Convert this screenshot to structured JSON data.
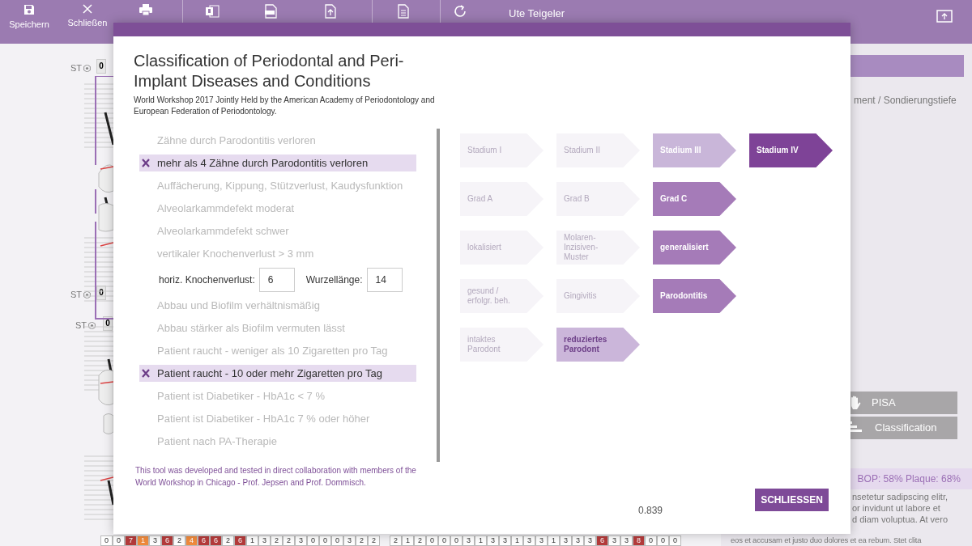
{
  "toolbar": {
    "buttons": [
      {
        "label": "Speichern"
      },
      {
        "label": "Schließen"
      }
    ],
    "patient_name": "Ute Teigeler"
  },
  "background_chart": {
    "st_rows": [
      {
        "label": "ST",
        "value": "0"
      },
      {
        "label": "ST",
        "value": "0"
      },
      {
        "label": "ST",
        "value": "0"
      }
    ],
    "bottom_cells": [
      {
        "value": "0",
        "color": "#ffffff"
      },
      {
        "value": "0",
        "color": "#ffffff"
      },
      {
        "value": "7",
        "color": "#b53b3b"
      },
      {
        "value": "1",
        "color": "#f08a3c"
      },
      {
        "value": "3",
        "color": "#ffffff"
      },
      {
        "value": "6",
        "color": "#b53b3b"
      },
      {
        "value": "2",
        "color": "#ffffff"
      },
      {
        "value": "4",
        "color": "#f08a3c"
      },
      {
        "value": "6",
        "color": "#b53b3b"
      },
      {
        "value": "6",
        "color": "#b53b3b"
      },
      {
        "value": "2",
        "color": "#ffffff"
      },
      {
        "value": "6",
        "color": "#b53b3b"
      },
      {
        "value": "1",
        "color": "#ffffff"
      },
      {
        "value": "3",
        "color": "#ffffff"
      },
      {
        "value": "2",
        "color": "#ffffff"
      },
      {
        "value": "2",
        "color": "#ffffff"
      },
      {
        "value": "3",
        "color": "#ffffff"
      },
      {
        "value": "0",
        "color": "#ffffff"
      },
      {
        "value": "0",
        "color": "#ffffff"
      },
      {
        "value": "0",
        "color": "#ffffff"
      },
      {
        "value": "3",
        "color": "#ffffff"
      },
      {
        "value": "2",
        "color": "#ffffff"
      },
      {
        "value": "2",
        "color": "#ffffff"
      },
      {
        "value": "2",
        "color": "#ffffff"
      },
      {
        "value": "1",
        "color": "#ffffff"
      },
      {
        "value": "2",
        "color": "#ffffff"
      },
      {
        "value": "0",
        "color": "#ffffff"
      },
      {
        "value": "0",
        "color": "#ffffff"
      },
      {
        "value": "0",
        "color": "#ffffff"
      },
      {
        "value": "3",
        "color": "#ffffff"
      },
      {
        "value": "1",
        "color": "#ffffff"
      },
      {
        "value": "3",
        "color": "#ffffff"
      },
      {
        "value": "3",
        "color": "#ffffff"
      },
      {
        "value": "1",
        "color": "#ffffff"
      },
      {
        "value": "3",
        "color": "#ffffff"
      },
      {
        "value": "3",
        "color": "#ffffff"
      },
      {
        "value": "1",
        "color": "#ffffff"
      },
      {
        "value": "3",
        "color": "#ffffff"
      },
      {
        "value": "3",
        "color": "#ffffff"
      },
      {
        "value": "3",
        "color": "#ffffff"
      },
      {
        "value": "6",
        "color": "#b53b3b"
      },
      {
        "value": "3",
        "color": "#ffffff"
      },
      {
        "value": "3",
        "color": "#ffffff"
      },
      {
        "value": "8",
        "color": "#b53b3b"
      },
      {
        "value": "0",
        "color": "#ffffff"
      },
      {
        "value": "0",
        "color": "#ffffff"
      },
      {
        "value": "0",
        "color": "#ffffff"
      }
    ]
  },
  "side_panel": {
    "heading": "ment / Sondierungstiefe",
    "buttons": [
      {
        "label": "PISA"
      },
      {
        "label": "Classification"
      }
    ],
    "summary": "BOP: 58% Plaque: 68%",
    "text_lines": [
      "nsetetur sadipscing elitr,",
      "or invidunt ut labore et",
      "d diam voluptua. At vero",
      "eos et accusam et justo duo dolores et ea rebum. Stet clita"
    ]
  },
  "dialog": {
    "title": "Classification of Periodontal and Peri-Implant Diseases and Conditions",
    "subtitle": "World Workshop 2017 Jointly Held by the American Academy of Periodontology and European Federation of Periodontology.",
    "criteria": [
      {
        "kind": "check",
        "label": "Zähne durch Parodontitis verloren",
        "checked": false
      },
      {
        "kind": "check",
        "label": "mehr als 4 Zähne durch Parodontitis verloren",
        "checked": true
      },
      {
        "kind": "check",
        "label": "Auffächerung, Kippung, Stützverlust, Kaudysfunktion",
        "checked": false
      },
      {
        "kind": "check",
        "label": "Alveolarkammdefekt moderat",
        "checked": false
      },
      {
        "kind": "check",
        "label": "Alveolarkammdefekt schwer",
        "checked": false
      },
      {
        "kind": "check",
        "label": "vertikaler Knochenverlust > 3 mm",
        "checked": false
      },
      {
        "kind": "inputs",
        "fields": [
          {
            "label": "horiz. Knochenverlust:",
            "value": "6"
          },
          {
            "label": "Wurzellänge:",
            "value": "14"
          }
        ]
      },
      {
        "kind": "check",
        "label": "Abbau und Biofilm verhältnismäßig",
        "checked": false
      },
      {
        "kind": "check",
        "label": "Abbau stärker als Biofilm vermuten lässt",
        "checked": false
      },
      {
        "kind": "check",
        "label": "Patient raucht - weniger als 10 Zigaretten pro Tag",
        "checked": false
      },
      {
        "kind": "check",
        "label": "Patient raucht - 10 oder mehr Zigaretten pro Tag",
        "checked": true
      },
      {
        "kind": "check",
        "label": "Patient ist Diabetiker - HbA1c < 7 %",
        "checked": false
      },
      {
        "kind": "check",
        "label": "Patient ist Diabetiker - HbA1c 7 % oder höher",
        "checked": false
      },
      {
        "kind": "check",
        "label": "Patient nach PA-Therapie",
        "checked": false
      }
    ],
    "result_rows": [
      [
        {
          "label": "Stadium I",
          "kind": "faded"
        },
        {
          "label": "Stadium II",
          "kind": "faded"
        },
        {
          "label": "Stadium III",
          "kind": "pale"
        },
        {
          "label": "Stadium IV",
          "kind": "strong"
        }
      ],
      [
        {
          "label": "Grad A",
          "kind": "faded"
        },
        {
          "label": "Grad B",
          "kind": "faded"
        },
        {
          "label": "Grad C",
          "kind": "medium"
        }
      ],
      [
        {
          "label": "lokalisiert",
          "kind": "faded"
        },
        {
          "label": "Molaren-Inzisiven-Muster",
          "kind": "faded"
        },
        {
          "label": "generalisiert",
          "kind": "medium"
        }
      ],
      [
        {
          "label": "gesund / erfolgr. beh.",
          "kind": "faded"
        },
        {
          "label": "Gingivitis",
          "kind": "faded"
        },
        {
          "label": "Parodontitis",
          "kind": "medium"
        }
      ],
      [
        {
          "label": "intaktes Parodont",
          "kind": "faded"
        },
        {
          "label": "reduziertes Parodont",
          "kind": "soft"
        }
      ]
    ],
    "footnote": "This tool was developed and tested in direct collaboration with members of the World Workshop in Chicago - Prof. Jepsen and Prof. Dommisch.",
    "score": "0.839",
    "close_button": "SCHLIESSEN"
  }
}
